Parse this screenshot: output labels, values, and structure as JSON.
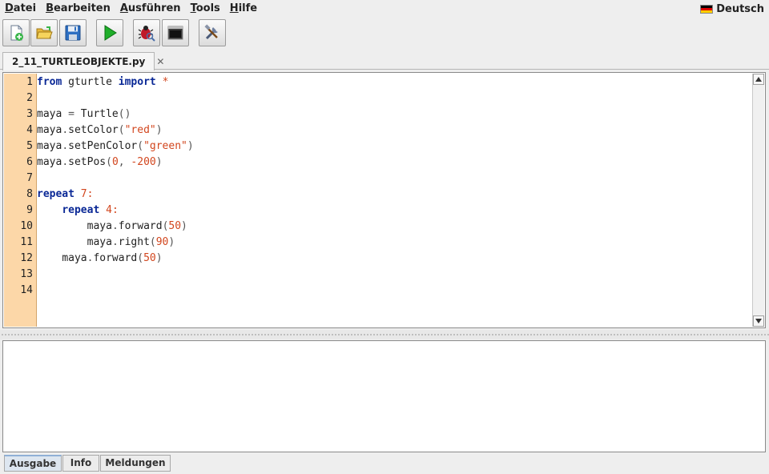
{
  "menu": {
    "items": [
      {
        "mnemonic": "D",
        "rest": "atei"
      },
      {
        "mnemonic": "B",
        "rest": "earbeiten"
      },
      {
        "mnemonic": "A",
        "rest": "usführen"
      },
      {
        "mnemonic": "T",
        "rest": "ools"
      },
      {
        "mnemonic": "H",
        "rest": "ilfe"
      }
    ],
    "language": "Deutsch"
  },
  "toolbar": {
    "buttons": [
      "new-file-icon",
      "open-folder-icon",
      "save-icon",
      "run-icon",
      "debug-icon",
      "console-icon",
      "tools-icon"
    ]
  },
  "editor_tab": {
    "filename": "2_11_TURTLEOBJEKTE.py",
    "close": "✕"
  },
  "editor": {
    "line_numbers": [
      "1",
      "2",
      "3",
      "4",
      "5",
      "6",
      "7",
      "8",
      "9",
      "10",
      "11",
      "12",
      "13",
      "14"
    ],
    "lines": [
      "from gturtle import *",
      "",
      "maya = Turtle()",
      "maya.setColor(\"red\")",
      "maya.setPenColor(\"green\")",
      "maya.setPos(0, -200)",
      "",
      "repeat 7:",
      "    repeat 4:",
      "        maya.forward(50)",
      "        maya.right(90)",
      "    maya.forward(50)",
      "",
      ""
    ]
  },
  "output_tabs": [
    {
      "label": "Ausgabe",
      "active": true
    },
    {
      "label": "Info",
      "active": false
    },
    {
      "label": "Meldungen",
      "active": false
    }
  ],
  "colors": {
    "keyword": "#0a2896",
    "string": "#d2461e",
    "gutter": "#fcd7a8"
  }
}
